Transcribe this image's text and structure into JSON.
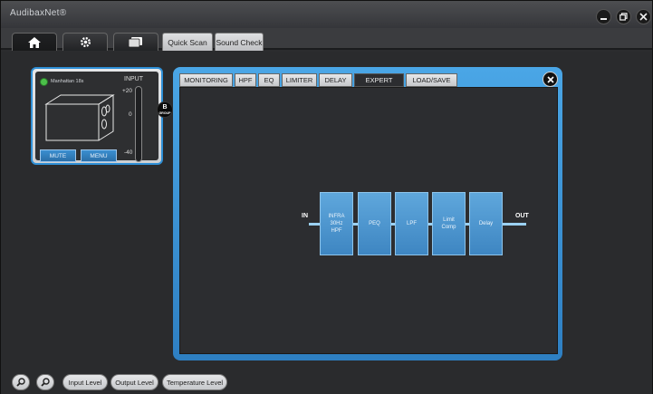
{
  "app": {
    "title": "AudibaxNet®"
  },
  "window_controls": {
    "minimize": "minimize-icon",
    "restore": "restore-icon",
    "close": "close-icon"
  },
  "main_tabs": {
    "icons": [
      "home-icon",
      "gear-icon",
      "monitor-icon"
    ],
    "text_tabs": [
      "Quick Scan",
      "Sound Check"
    ]
  },
  "device": {
    "name": "Manhattan 18s",
    "status_color": "#4cc04a",
    "meter_label": "INPUT",
    "meter_ticks": [
      "+20",
      "0",
      "-40"
    ],
    "buttons": {
      "mute": "MUTE",
      "menu": "MENU"
    },
    "group_badge": {
      "letter": "B",
      "label": "GROUP"
    }
  },
  "panel": {
    "tabs": [
      "MONITORING",
      "HPF",
      "EQ",
      "LIMITER",
      "DELAY",
      "EXPERT",
      "LOAD/SAVE"
    ],
    "active_tab": "EXPERT",
    "accent": "#2e8fd6",
    "signal_chain": {
      "in_label": "IN",
      "out_label": "OUT",
      "blocks": [
        "INFRA\n30Hz\nHPF",
        "PEQ",
        "LPF",
        "Limit\nComp",
        "Delay"
      ]
    }
  },
  "bottom_bar": {
    "zoom_in": "zoom-in-icon",
    "zoom_out": "zoom-out-icon",
    "buttons": [
      "Input Level",
      "Output Level",
      "Temperature Level"
    ]
  }
}
